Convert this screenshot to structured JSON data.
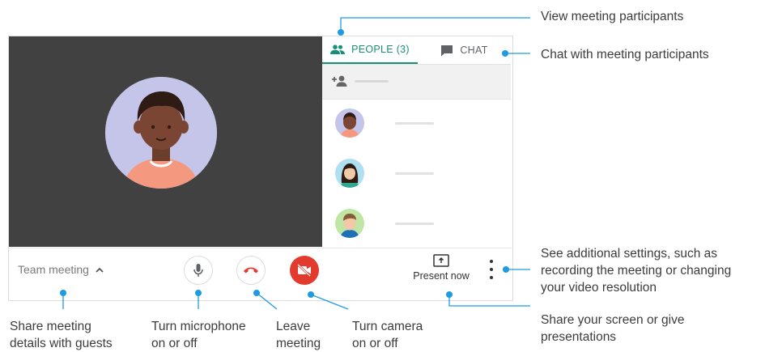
{
  "tabs": {
    "people_label": "PEOPLE (3)",
    "chat_label": "CHAT"
  },
  "meeting": {
    "name": "Team meeting",
    "present_label": "Present now"
  },
  "annotations": {
    "view_participants": "View meeting participants",
    "chat": "Chat with meeting participants",
    "settings": "See additional settings, such as\nrecording the meeting or changing\nyour video resolution",
    "share_screen": "Share your screen or give\npresentations",
    "share_details": "Share meeting\ndetails with guests",
    "microphone": "Turn microphone\non or off",
    "leave": "Leave\nmeeting",
    "camera": "Turn camera\non or off"
  },
  "colors": {
    "accent": "#1a8f77",
    "callout": "#1e9be3",
    "hangup": "#e23b2e",
    "video_bg": "#414141"
  },
  "icons": [
    "people-icon",
    "chat-icon",
    "add-person-icon",
    "mic-icon",
    "hang-up-icon",
    "camera-off-icon",
    "present-icon",
    "more-vert-icon",
    "chevron-up-icon"
  ]
}
